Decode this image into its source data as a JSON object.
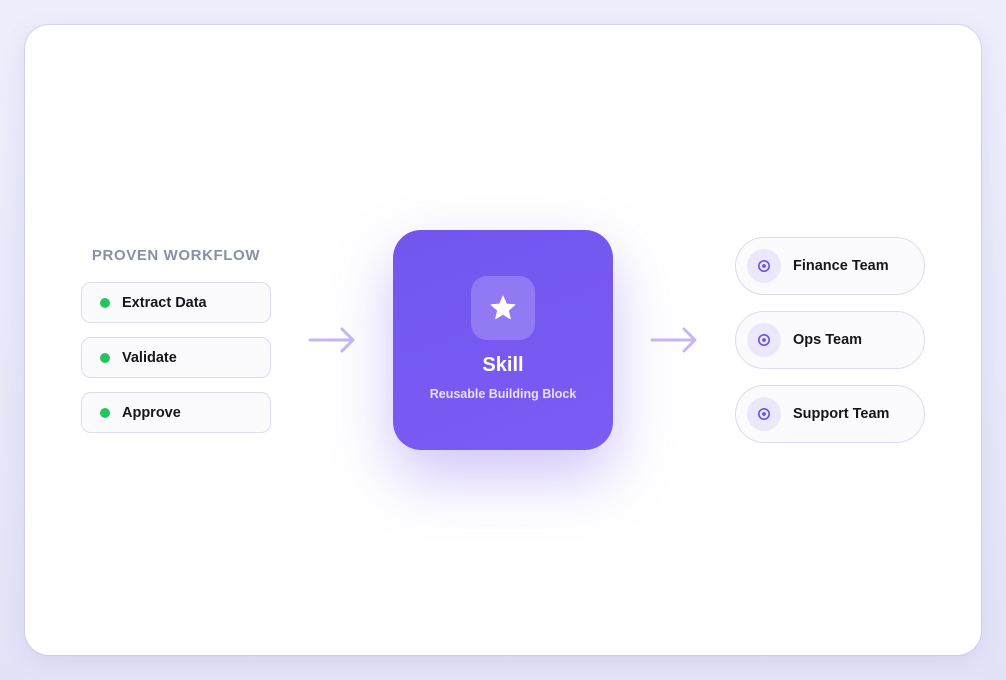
{
  "workflow": {
    "title": "PROVEN WORKFLOW",
    "steps": [
      {
        "label": "Extract Data"
      },
      {
        "label": "Validate"
      },
      {
        "label": "Approve"
      }
    ]
  },
  "skill": {
    "title": "Skill",
    "subtitle": "Reusable Building Block",
    "icon": "star-icon"
  },
  "teams": [
    {
      "label": "Finance Team",
      "icon": "target-icon"
    },
    {
      "label": "Ops Team",
      "icon": "target-icon"
    },
    {
      "label": "Support Team",
      "icon": "target-icon"
    }
  ],
  "colors": {
    "accent": "#7256ee",
    "accent_light": "#7b5cf5",
    "step_dot": "#22c55e",
    "arrow": "#c6b7f2",
    "team_icon": "#6d4ee6"
  }
}
